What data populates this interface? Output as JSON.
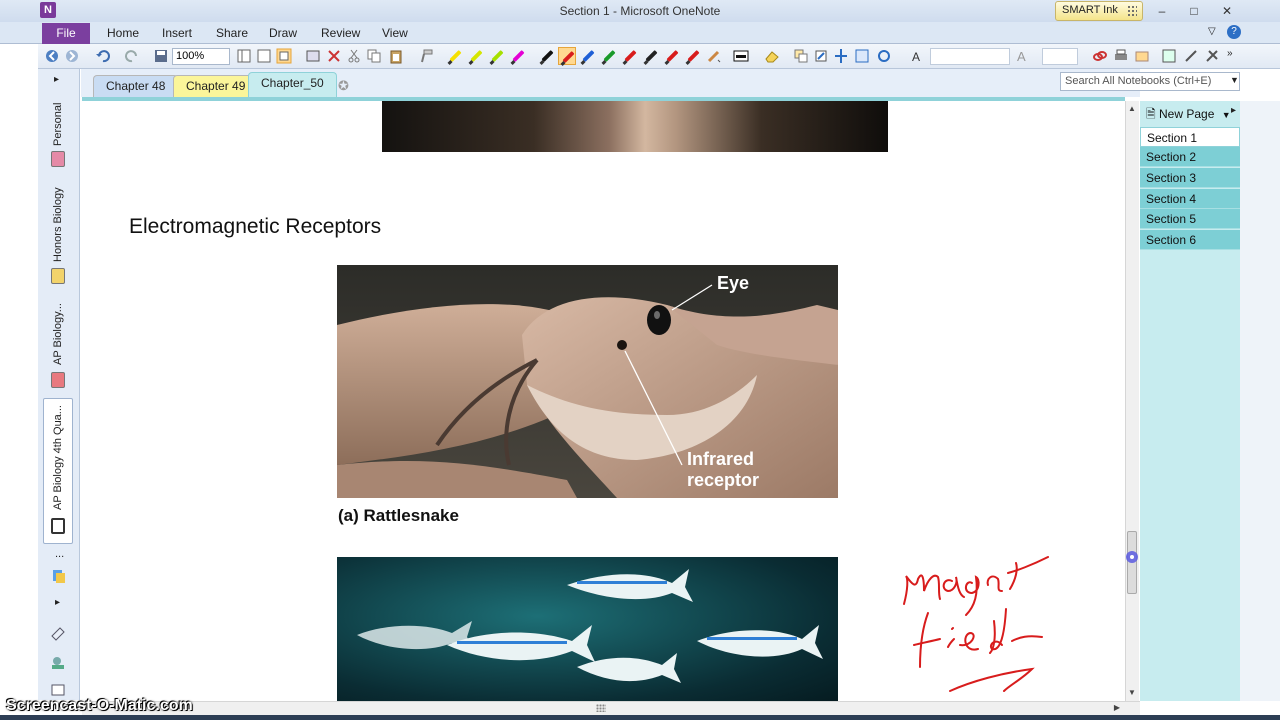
{
  "window": {
    "title": "Section 1  -  Microsoft OneNote",
    "app_icon": "N",
    "smart_ink": "SMART Ink",
    "controls": {
      "minimize": "–",
      "maximize": "□",
      "close": "✕"
    }
  },
  "ribbon": {
    "file_label": "File",
    "tabs": [
      "Home",
      "Insert",
      "Share",
      "Draw",
      "Review",
      "View"
    ],
    "zoom": "100%"
  },
  "notebooks": {
    "items": [
      {
        "label": "Personal",
        "color": "#e58aa7"
      },
      {
        "label": "Honors Biology",
        "color": "#f2d36b"
      },
      {
        "label": "AP Biology...",
        "color": "#e8797f"
      },
      {
        "label": "AP Biology 4th Qua...",
        "color": "#ffffff"
      }
    ],
    "more": "..."
  },
  "section_tabs": [
    {
      "label": "Chapter 48",
      "color": "#c9dcf3"
    },
    {
      "label": "Chapter 49",
      "color": "#fbf59a"
    },
    {
      "label": "Chapter_50",
      "color": "#c7ecef"
    }
  ],
  "search": {
    "placeholder": "Search All Notebooks (Ctrl+E)"
  },
  "page": {
    "heading": "Electromagnetic Receptors",
    "figure_a": {
      "label_eye": "Eye",
      "label_infrared_1": "Infrared",
      "label_infrared_2": "receptor",
      "caption": "(a) Rattlesnake"
    }
  },
  "pages_panel": {
    "new_page": "New Page",
    "pages": [
      "Section 1",
      "Section 2",
      "Section 3",
      "Section 4",
      "Section 5",
      "Section 6"
    ],
    "active_index": 0
  },
  "ink_color": "#d81c1c",
  "watermark": "Screencast-O-Matic.com"
}
